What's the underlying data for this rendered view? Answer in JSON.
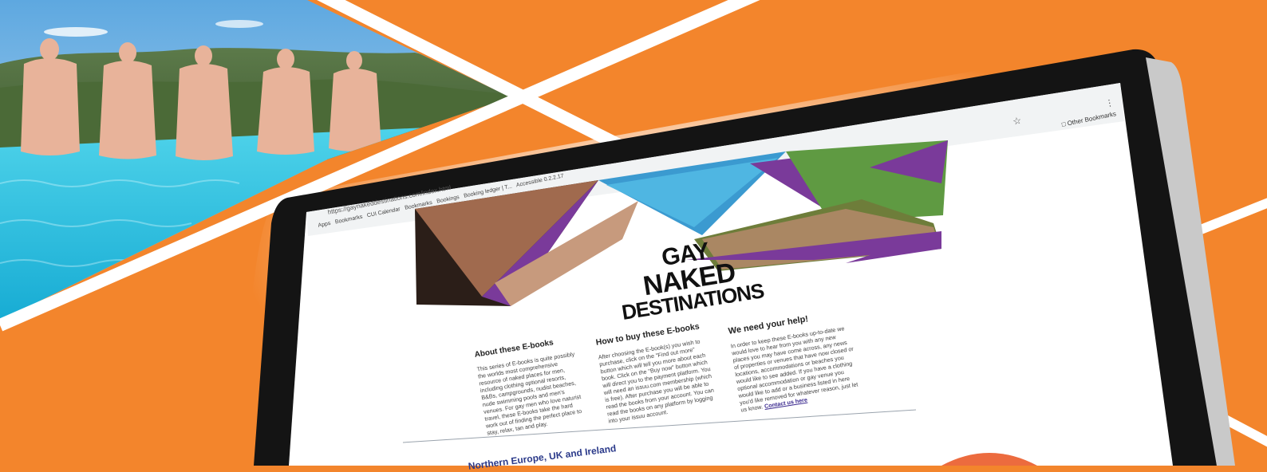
{
  "browser": {
    "url": "https://gaynakeddestinations.com/index.html",
    "bookmarks": [
      "Apps",
      "Bookmarks",
      "CUI Calendar",
      "Bookmarks",
      "Bookings",
      "Booking ledger | T...",
      "Accessible 0.2.2.17"
    ],
    "other_bookmarks": "Other Bookmarks"
  },
  "site": {
    "logo": {
      "line1": "GAY",
      "line2": "NAKED",
      "line3": "DESTINATIONS"
    },
    "sections": [
      {
        "title": "About these E-books",
        "body": "This series of E-books is quite possibly the worlds most comprehensive resource of naked places for men, including clothing optional resorts, B&Bs, campgrounds, nudist beaches, nude swimming pools and men's venues. For gay men who love naturist travel, these E-books take the hard work out of finding the perfect place to stay, relax, tan and play."
      },
      {
        "title": "How to buy these E-books",
        "body": "After choosing the E-book(s) you wish to purchase, click on the \"Find out more\" button which will tell you more about each book. Click on the \"Buy now\" button which will direct you to the payment platform. You will need an issuu.com membership (which is free). After purchase you will be able to read the books from your account. You can read the books on any platform by logging into your issuu account."
      },
      {
        "title": "We need your help!",
        "body": "In order to keep these E-books up-to-date we would love to hear from you with any new places you may have come across, any news of properties or venues that have now closed or locations, accommodations or beaches you would like to see added. If you have a clothing optional accommodation or gay venue you would like to add or a business listed in here you'd like removed for whatever reason, just let us know.",
        "link": "Contact us here"
      }
    ],
    "region_heading": "Northern Europe, UK and Ireland"
  },
  "colors": {
    "background_orange": "#f3852c",
    "logo_purple": "#7a3a9a",
    "monitor_frame": "#1a1a1a",
    "sky": "#8fc4ea",
    "pool_water": "#3cc9e6"
  }
}
